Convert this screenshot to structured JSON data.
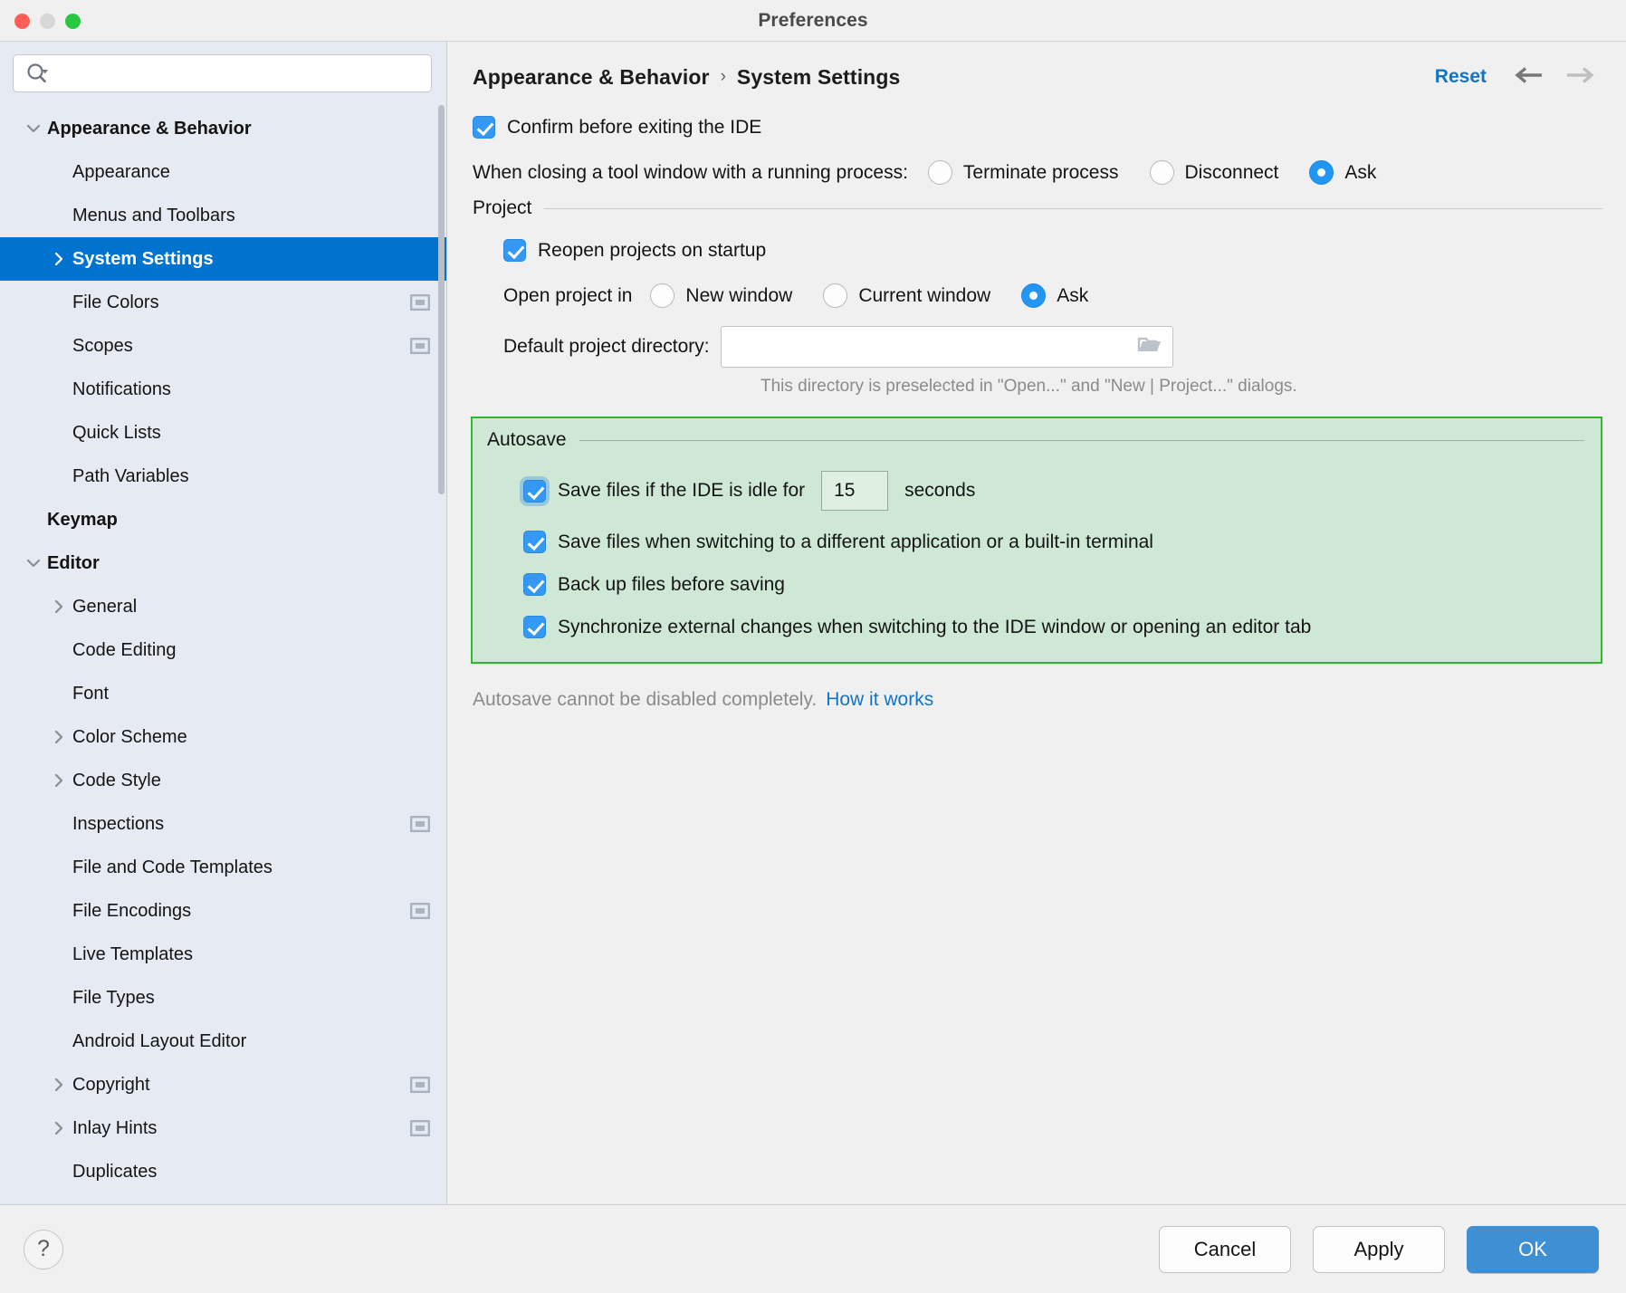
{
  "window": {
    "title": "Preferences",
    "traffic_lights": [
      "close",
      "minimize",
      "zoom"
    ]
  },
  "sidebar": {
    "search": {
      "value": "",
      "placeholder": ""
    },
    "items": [
      {
        "label": "Appearance & Behavior",
        "level": 0,
        "twisty": "down",
        "bold": true,
        "selected": false,
        "badge": false
      },
      {
        "label": "Appearance",
        "level": 1,
        "twisty": "none",
        "bold": false,
        "selected": false,
        "badge": false
      },
      {
        "label": "Menus and Toolbars",
        "level": 1,
        "twisty": "none",
        "bold": false,
        "selected": false,
        "badge": false
      },
      {
        "label": "System Settings",
        "level": 1,
        "twisty": "right",
        "bold": true,
        "selected": true,
        "badge": false
      },
      {
        "label": "File Colors",
        "level": 1,
        "twisty": "none",
        "bold": false,
        "selected": false,
        "badge": true
      },
      {
        "label": "Scopes",
        "level": 1,
        "twisty": "none",
        "bold": false,
        "selected": false,
        "badge": true
      },
      {
        "label": "Notifications",
        "level": 1,
        "twisty": "none",
        "bold": false,
        "selected": false,
        "badge": false
      },
      {
        "label": "Quick Lists",
        "level": 1,
        "twisty": "none",
        "bold": false,
        "selected": false,
        "badge": false
      },
      {
        "label": "Path Variables",
        "level": 1,
        "twisty": "none",
        "bold": false,
        "selected": false,
        "badge": false
      },
      {
        "label": "Keymap",
        "level": 0,
        "twisty": "none",
        "bold": true,
        "selected": false,
        "badge": false
      },
      {
        "label": "Editor",
        "level": 0,
        "twisty": "down",
        "bold": true,
        "selected": false,
        "badge": false
      },
      {
        "label": "General",
        "level": 1,
        "twisty": "right",
        "bold": false,
        "selected": false,
        "badge": false
      },
      {
        "label": "Code Editing",
        "level": 1,
        "twisty": "none",
        "bold": false,
        "selected": false,
        "badge": false
      },
      {
        "label": "Font",
        "level": 1,
        "twisty": "none",
        "bold": false,
        "selected": false,
        "badge": false
      },
      {
        "label": "Color Scheme",
        "level": 1,
        "twisty": "right",
        "bold": false,
        "selected": false,
        "badge": false
      },
      {
        "label": "Code Style",
        "level": 1,
        "twisty": "right",
        "bold": false,
        "selected": false,
        "badge": false
      },
      {
        "label": "Inspections",
        "level": 1,
        "twisty": "none",
        "bold": false,
        "selected": false,
        "badge": true
      },
      {
        "label": "File and Code Templates",
        "level": 1,
        "twisty": "none",
        "bold": false,
        "selected": false,
        "badge": false
      },
      {
        "label": "File Encodings",
        "level": 1,
        "twisty": "none",
        "bold": false,
        "selected": false,
        "badge": true
      },
      {
        "label": "Live Templates",
        "level": 1,
        "twisty": "none",
        "bold": false,
        "selected": false,
        "badge": false
      },
      {
        "label": "File Types",
        "level": 1,
        "twisty": "none",
        "bold": false,
        "selected": false,
        "badge": false
      },
      {
        "label": "Android Layout Editor",
        "level": 1,
        "twisty": "none",
        "bold": false,
        "selected": false,
        "badge": false
      },
      {
        "label": "Copyright",
        "level": 1,
        "twisty": "right",
        "bold": false,
        "selected": false,
        "badge": true
      },
      {
        "label": "Inlay Hints",
        "level": 1,
        "twisty": "right",
        "bold": false,
        "selected": false,
        "badge": true
      },
      {
        "label": "Duplicates",
        "level": 1,
        "twisty": "none",
        "bold": false,
        "selected": false,
        "badge": false
      }
    ]
  },
  "header": {
    "breadcrumb": [
      "Appearance & Behavior",
      "System Settings"
    ],
    "separator": "›",
    "reset_label": "Reset",
    "back_arrow": "←",
    "forward_arrow": "→"
  },
  "main": {
    "confirm_exit": {
      "label": "Confirm before exiting the IDE",
      "checked": true
    },
    "closing_tool_window": {
      "label": "When closing a tool window with a running process:",
      "options": [
        {
          "label": "Terminate process",
          "selected": false
        },
        {
          "label": "Disconnect",
          "selected": false
        },
        {
          "label": "Ask",
          "selected": true
        }
      ]
    },
    "project": {
      "title": "Project",
      "reopen": {
        "label": "Reopen projects on startup",
        "checked": true
      },
      "open_project_in": {
        "label": "Open project in",
        "options": [
          {
            "label": "New window",
            "selected": false
          },
          {
            "label": "Current window",
            "selected": false
          },
          {
            "label": "Ask",
            "selected": true
          }
        ]
      },
      "default_directory": {
        "label": "Default project directory:",
        "value": "",
        "placeholder": "",
        "browse_icon": "folder-icon"
      },
      "hint": "This directory is preselected in \"Open...\" and \"New | Project...\" dialogs."
    },
    "autosave": {
      "title": "Autosave",
      "idle": {
        "label_before": "Save files if the IDE is idle for",
        "seconds_value": "15",
        "label_after": "seconds",
        "checked": true,
        "focused": true
      },
      "checkboxes": [
        {
          "label": "Save files when switching to a different application or a built-in terminal",
          "checked": true
        },
        {
          "label": "Back up files before saving",
          "checked": true
        },
        {
          "label": "Synchronize external changes when switching to the IDE window or opening an editor tab",
          "checked": true
        }
      ]
    },
    "footer_note": {
      "text": "Autosave cannot be disabled completely.",
      "link": "How it works"
    }
  },
  "footer": {
    "help_label": "?",
    "cancel_label": "Cancel",
    "apply_label": "Apply",
    "ok_label": "OK"
  },
  "colors": {
    "accent_blue": "#0073cf",
    "link_blue": "#1474c4",
    "checkbox_blue": "#3399f4",
    "radio_blue": "#2196f3",
    "highlight_green_border": "#2eb82e",
    "highlight_green_fill": "#cfe8d5",
    "sidebar_bg": "#e6eaf2",
    "content_bg": "#f0f0f0",
    "primary_button": "#3f8fd4"
  }
}
